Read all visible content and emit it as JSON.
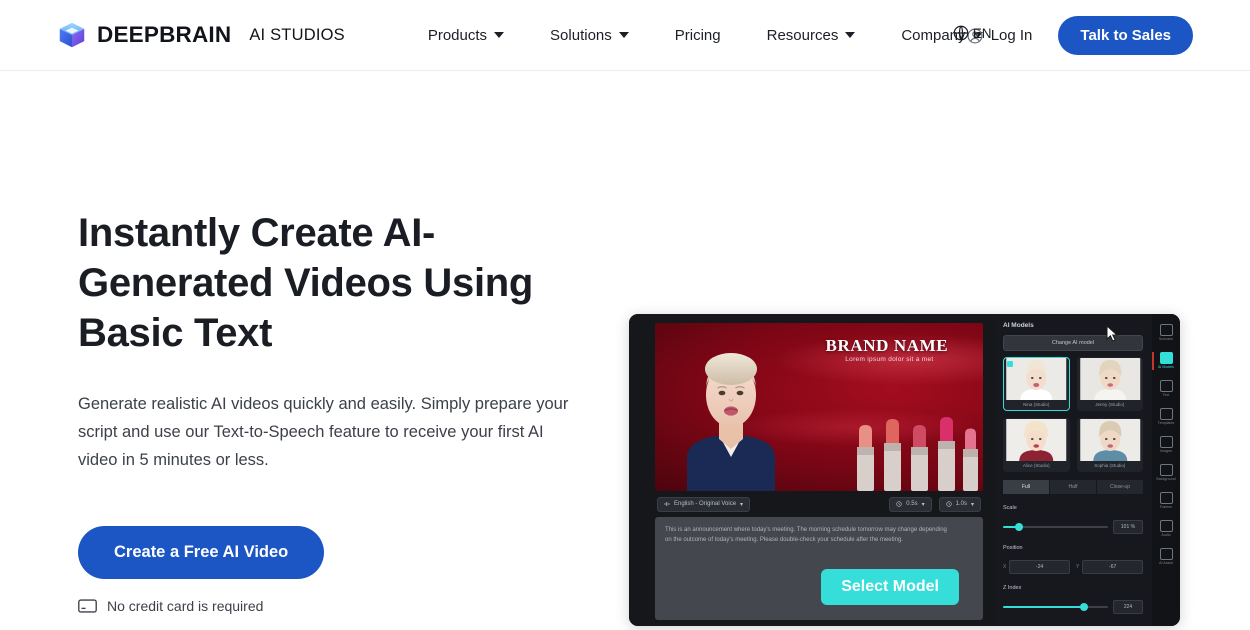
{
  "header": {
    "logo_icon": "cube-logo-icon",
    "brand_name": "DEEPBRAIN",
    "brand_sub": "AI STUDIOS",
    "nav": [
      {
        "label": "Products",
        "has_caret": true
      },
      {
        "label": "Solutions",
        "has_caret": true
      },
      {
        "label": "Pricing",
        "has_caret": false
      },
      {
        "label": "Resources",
        "has_caret": true
      },
      {
        "label": "Company",
        "has_caret": true
      }
    ],
    "language": {
      "icon": "globe-icon",
      "label": "EN"
    },
    "login": {
      "icon": "user-circle-icon",
      "label": "Log In"
    },
    "cta": {
      "label": "Talk to Sales",
      "color": "#1b56c4"
    }
  },
  "hero": {
    "title": "Instantly Create AI-Generated Videos Using Basic Text",
    "subtitle": "Generate realistic AI videos quickly and easily. Simply prepare your script and use our Text-to-Speech feature to receive your first AI video in 5 minutes or less.",
    "cta": {
      "label": "Create a Free AI Video",
      "color": "#1b56c4"
    },
    "note": {
      "icon": "credit-card-icon",
      "label": "No credit card is required"
    }
  },
  "mockup": {
    "stage": {
      "brand_title": "BRAND NAME",
      "brand_subtitle": "Lorem ipsum dolor sit a met",
      "background_color": "#8d0a1c"
    },
    "stage_toolbar": {
      "voice_chip": {
        "icon": "sound-wave-icon",
        "label": "English - Original Voice"
      },
      "time_chips": [
        {
          "icon": "clock-icon",
          "label": "0.5s"
        },
        {
          "icon": "clock-icon",
          "label": "1.0s"
        }
      ]
    },
    "script": "This is an announcement where today's meeting. The morning schedule tomorrow may change depending on the outcome of today's meeting. Please double-check your schedule after the meeting.",
    "select_button": {
      "label": "Select Model",
      "color": "#35ded9"
    },
    "panel": {
      "title": "AI Models",
      "change_button": "Change AI model",
      "models": [
        {
          "name": "Nina (Studio)",
          "selected": true
        },
        {
          "name": "Jenny (Studio)",
          "selected": false
        },
        {
          "name": "Alice (Studio)",
          "selected": false
        },
        {
          "name": "Sophia (Studio)",
          "selected": false
        }
      ],
      "crop_tabs": [
        {
          "label": "Full",
          "active": true
        },
        {
          "label": "Half",
          "active": false
        },
        {
          "label": "Close-up",
          "active": false
        }
      ],
      "scale": {
        "label": "Scale",
        "value": "101 %",
        "fill_pct": 14
      },
      "position": {
        "label": "Position",
        "x_key": "X",
        "x_value": "-24",
        "y_key": "Y",
        "y_value": "-67"
      },
      "zindex": {
        "label": "Z Index",
        "value": "224",
        "fill_pct": 76
      }
    },
    "rail": [
      {
        "label": "Scenario",
        "icon": "scenario-icon",
        "active": false
      },
      {
        "label": "AI Models",
        "icon": "ai-model-icon",
        "active": true
      },
      {
        "label": "Text",
        "icon": "text-icon",
        "active": false
      },
      {
        "label": "Templates",
        "icon": "template-icon",
        "active": false
      },
      {
        "label": "Images",
        "icon": "image-icon",
        "active": false
      },
      {
        "label": "Background",
        "icon": "background-icon",
        "active": false
      },
      {
        "label": "Frames",
        "icon": "frame-icon",
        "active": false
      },
      {
        "label": "Audio",
        "icon": "audio-icon",
        "active": false
      },
      {
        "label": "AI Assist",
        "icon": "ai-assist-icon",
        "active": false
      }
    ],
    "cursor": {
      "icon": "cursor-arrow-icon"
    }
  }
}
